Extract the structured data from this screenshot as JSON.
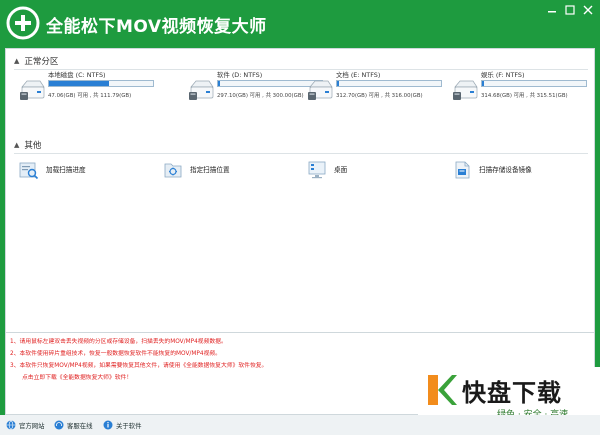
{
  "app": {
    "title": "全能松下MOV视频恢复大师"
  },
  "colors": {
    "title_bar": "#1e9b3f",
    "accent": "#2a7fd4",
    "note_text": "#e02020"
  },
  "sections": {
    "partitions": "正常分区",
    "other": "其他"
  },
  "drives": [
    {
      "name": "本地磁盘 (C: NTFS)",
      "size": "47.06(GB) 可用 , 共 111.79(GB)",
      "used_fraction": 0.58,
      "icon": "hard-drive-icon"
    },
    {
      "name": "软件 (D: NTFS)",
      "size": "297.10(GB) 可用 , 共 300.00(GB)",
      "used_fraction": 0.01,
      "icon": "hard-drive-icon"
    },
    {
      "name": "文档 (E: NTFS)",
      "size": "312.70(GB) 可用 , 共 316.00(GB)",
      "used_fraction": 0.01,
      "icon": "hard-drive-icon"
    },
    {
      "name": "娱乐 (F: NTFS)",
      "size": "314.68(GB) 可用 , 共 315.51(GB)",
      "used_fraction": 0.0,
      "icon": "hard-drive-icon"
    }
  ],
  "tools": [
    {
      "label": "加载扫描进度",
      "icon": "load-progress-icon"
    },
    {
      "label": "指定扫描位置",
      "icon": "scan-location-icon"
    },
    {
      "label": "桌面",
      "icon": "desktop-icon"
    },
    {
      "label": "扫描存储设备镜像",
      "icon": "disk-image-icon"
    }
  ],
  "notes": [
    "1、请用鼠标左建双击丢失视频的分区或存储设备，扫描丢失的MOV/MP4视频数据。",
    "2、本软件使用碎片重组技术，恢复一般数据恢复软件不能恢复的MOV/MP4视频。",
    "3、本软件只恢复MOV/MP4视频，如果需要恢复其他文件，请使用《全能数据恢复大师》软件恢复。",
    "点击立即下载《全能数据恢复大师》软件！"
  ],
  "status": {
    "website": "官方网站",
    "support": "客服在线",
    "about": "关于软件"
  },
  "watermark": {
    "brand": "快盘下载",
    "slogan": "绿色 · 安全 · 高速"
  }
}
